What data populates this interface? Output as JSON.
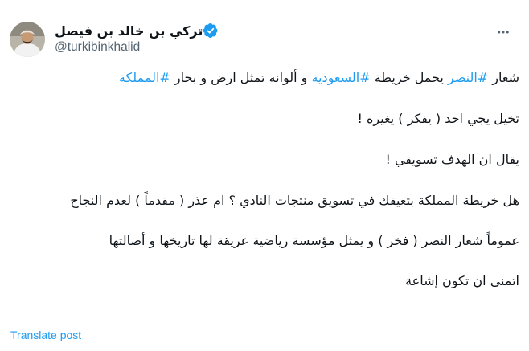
{
  "author": {
    "display_name": "تركي بن خالد بن فيصل",
    "handle": "@turkibinkhalid",
    "verified": true,
    "avatar_icon": "profile-photo",
    "verified_icon": "verified-badge-icon"
  },
  "more_icon": "more-options-icon",
  "tweet": {
    "p1": {
      "t1": "شعار ",
      "h1": "#النصر",
      "t2": " يحمل خريطة ",
      "h2": "#السعودية",
      "t3": " و ألوانه تمثل ارض و بحار ",
      "h3": "#المملكة"
    },
    "p2": "تخيل يجي احد ( يفكر ) يغيره !",
    "p3": "يقال ان الهدف تسويقي !",
    "p4": "هل خريطة المملكة بتعيقك في تسويق منتجات النادي ؟ ام عذر ( مقدماً ) لعدم النجاح",
    "p5": "عموماً شعار النصر  ( فخر ) و يمثل مؤسسة رياضية عريقة لها تاريخها و أصالتها",
    "p6": "اتمنى ان تكون إشاعة"
  },
  "translate_label": "Translate post",
  "colors": {
    "link": "#1d9bf0",
    "text": "#0f1419",
    "secondary": "#536471",
    "verified": "#1d9bf0"
  }
}
